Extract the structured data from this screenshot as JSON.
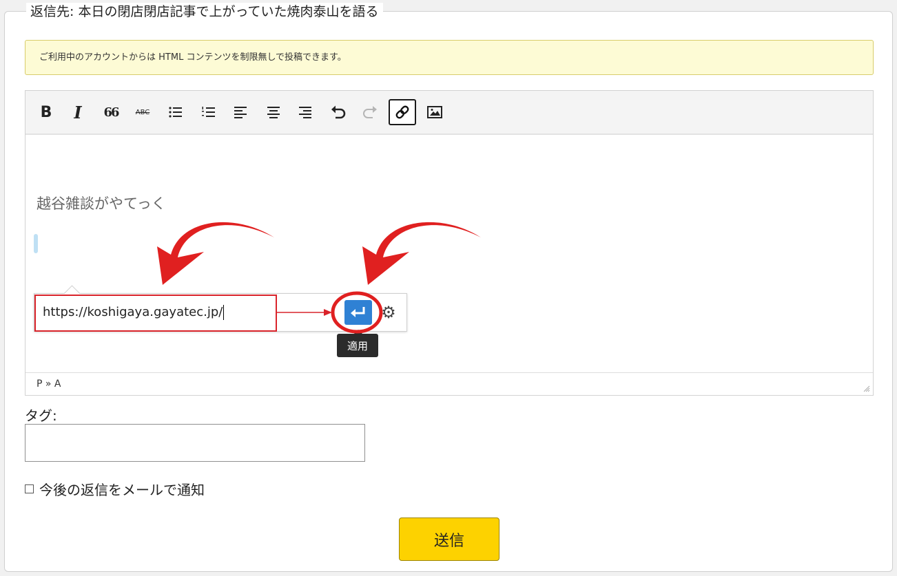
{
  "reply_legend": "返信先: 本日の閉店閉店記事で上がっていた焼肉泰山を語る",
  "notice": "ご利用中のアカウントからは HTML コンテンツを制限無しで投稿できます。",
  "toolbar": {
    "bold": "B",
    "italic": "I",
    "blockquote": "66",
    "strikethrough": "ABC"
  },
  "editor": {
    "content_text": "越谷雑談がやてっく",
    "link_url": "https://koshigaya.gayatec.jp/",
    "apply_tooltip": "適用",
    "status_path": "P » A"
  },
  "tag": {
    "label": "タグ:",
    "value": ""
  },
  "notify_label": "今後の返信をメールで通知",
  "submit_label": "送信",
  "colors": {
    "annotation_red": "#e02020",
    "apply_blue": "#2f81d4",
    "submit_yellow": "#fdd200",
    "notice_bg": "#fdfbd5"
  }
}
